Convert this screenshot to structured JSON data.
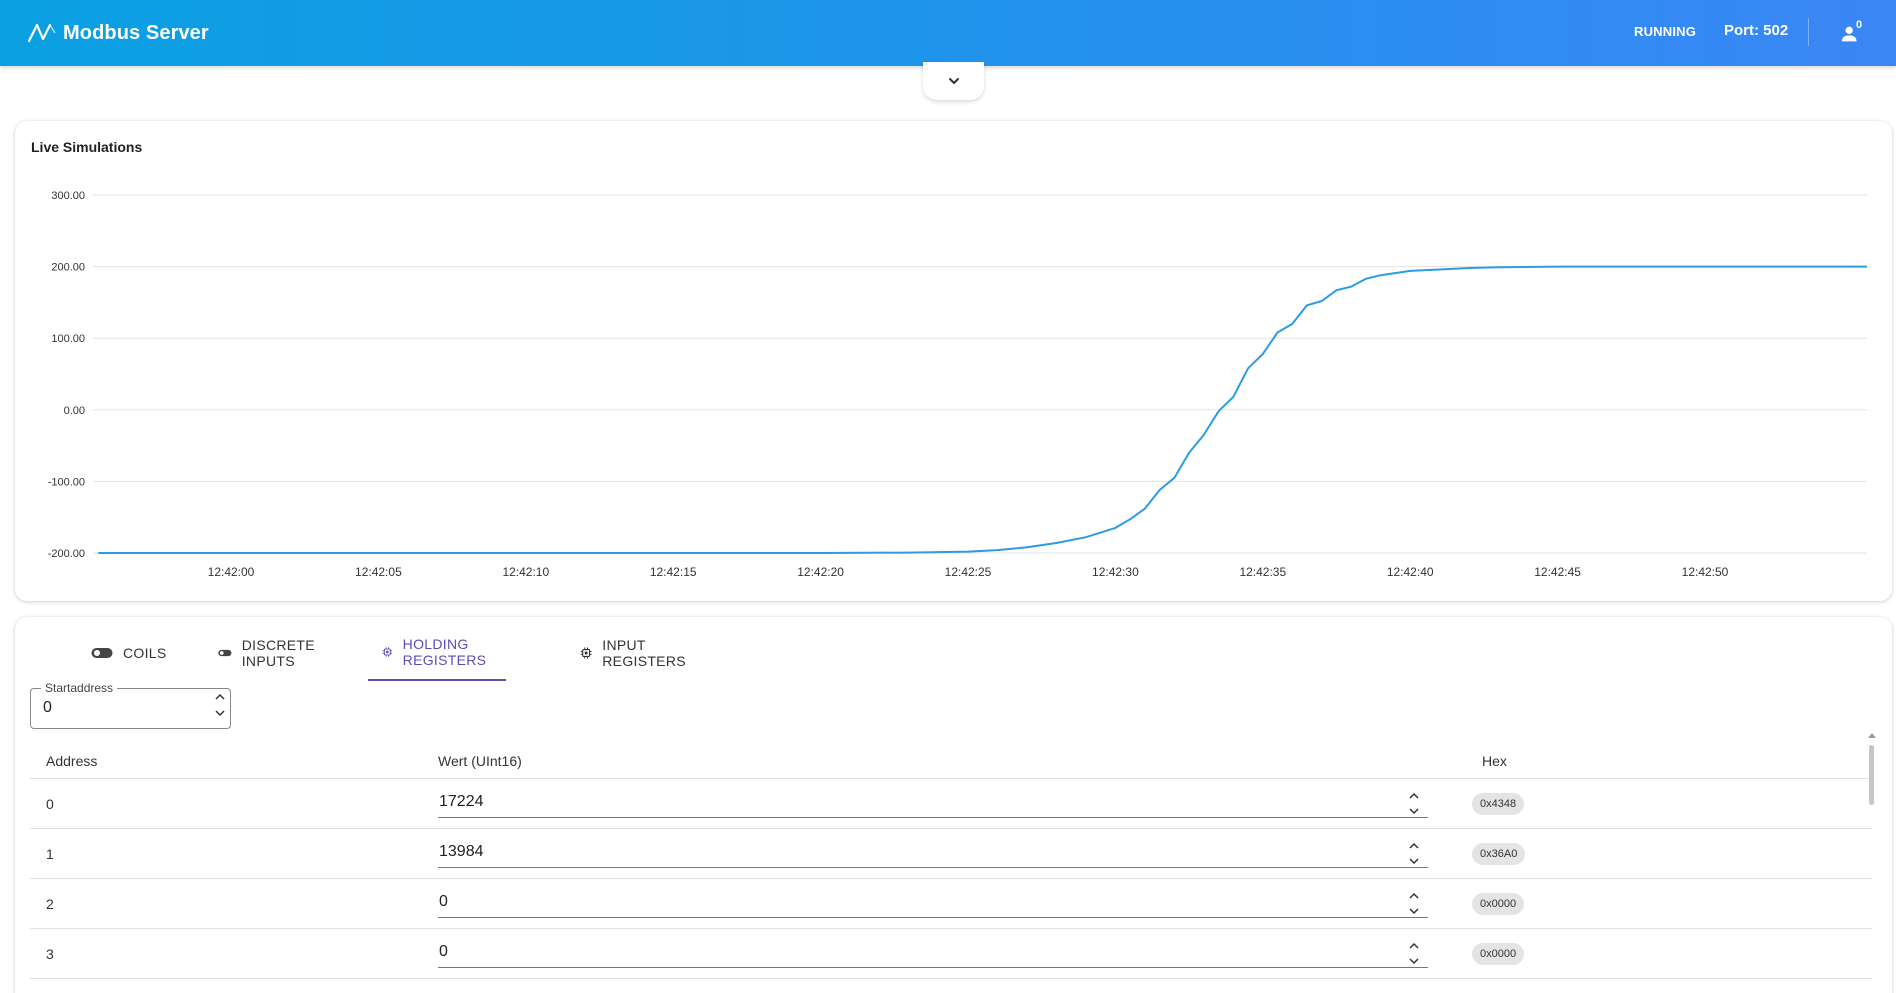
{
  "header": {
    "title": "Modbus Server",
    "status": "RUNNING",
    "port": "Port: 502",
    "user_count": "0",
    "brand_color": "#0aa0e2"
  },
  "chart_card": {
    "title": "Live Simulations"
  },
  "chart_data": {
    "type": "line",
    "title": "Live Simulations",
    "xlabel": "",
    "ylabel": "",
    "ylim": [
      -200,
      300
    ],
    "y_ticks": [
      "300.00",
      "200.00",
      "100.00",
      "0.00",
      "-100.00",
      "-200.00"
    ],
    "x_ticks": [
      "12:42:00",
      "12:42:05",
      "12:42:10",
      "12:42:15",
      "12:42:20",
      "12:42:25",
      "12:42:30",
      "12:42:35",
      "12:42:40",
      "12:42:45",
      "12:42:50"
    ],
    "grid": true,
    "color": "#2d9be0",
    "series": [
      {
        "x": [
          "12:41:55.5",
          "12:42:00",
          "12:42:05",
          "12:42:10",
          "12:42:15",
          "12:42:20",
          "12:42:23",
          "12:42:25",
          "12:42:26",
          "12:42:27",
          "12:42:28",
          "12:42:29",
          "12:42:30",
          "12:42:30.5",
          "12:42:31",
          "12:42:31.5",
          "12:42:32",
          "12:42:32.5",
          "12:42:33",
          "12:42:33.5",
          "12:42:34",
          "12:42:34.5",
          "12:42:35",
          "12:42:35.5",
          "12:42:36",
          "12:42:36.5",
          "12:42:37",
          "12:42:37.5",
          "12:42:38",
          "12:42:38.5",
          "12:42:39",
          "12:42:40",
          "12:42:41",
          "12:42:42",
          "12:42:43",
          "12:42:45",
          "12:42:48",
          "12:42:50",
          "12:42:52",
          "12:42:55.5"
        ],
        "values": [
          -200,
          -200,
          -200,
          -200,
          -200,
          -200,
          -199.5,
          -198,
          -196,
          -192,
          -186,
          -178,
          -165,
          -153,
          -138,
          -112,
          -95,
          -60,
          -35,
          -2,
          18,
          58,
          78,
          108,
          120,
          146,
          152,
          167,
          172,
          183,
          188,
          194,
          196,
          198,
          199,
          200,
          200,
          200,
          200,
          200
        ]
      }
    ]
  },
  "tabs": [
    {
      "label": "COILS",
      "icon": "toggle-icon"
    },
    {
      "label": "DISCRETE INPUTS",
      "icon": "toggle-icon"
    },
    {
      "label": "HOLDING REGISTERS",
      "icon": "chip-icon",
      "active": true
    },
    {
      "label": "INPUT REGISTERS",
      "icon": "chip-icon"
    }
  ],
  "start_address": {
    "label": "Startaddress",
    "value": "0"
  },
  "table": {
    "headers": [
      "Address",
      "Wert (UInt16)",
      "Hex"
    ],
    "rows": [
      {
        "address": "0",
        "value": "17224",
        "hex": "0x4348"
      },
      {
        "address": "1",
        "value": "13984",
        "hex": "0x36A0"
      },
      {
        "address": "2",
        "value": "0",
        "hex": "0x0000"
      },
      {
        "address": "3",
        "value": "0",
        "hex": "0x0000"
      }
    ]
  }
}
